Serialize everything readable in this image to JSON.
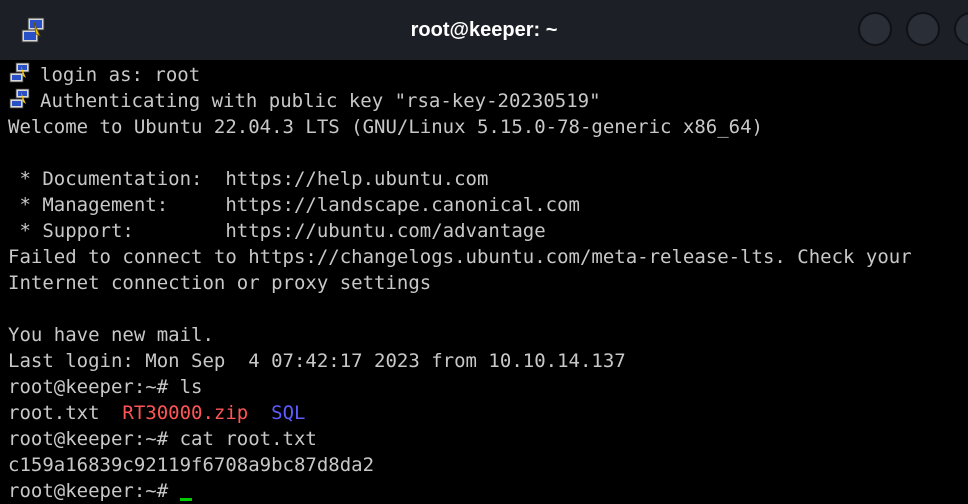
{
  "window": {
    "title": "root@keeper: ~",
    "app_icon": "putty-icon"
  },
  "terminal": {
    "line1": "login as: root",
    "line2": "Authenticating with public key \"rsa-key-20230519\"",
    "line3": "Welcome to Ubuntu 22.04.3 LTS (GNU/Linux 5.15.0-78-generic x86_64)",
    "line5": " * Documentation:  https://help.ubuntu.com",
    "line6": " * Management:     https://landscape.canonical.com",
    "line7": " * Support:        https://ubuntu.com/advantage",
    "line8": "Failed to connect to https://changelogs.ubuntu.com/meta-release-lts. Check your",
    "line9": "Internet connection or proxy settings",
    "line11": "You have new mail.",
    "line12": "Last login: Mon Sep  4 07:42:17 2023 from 10.10.14.137",
    "line13": "root@keeper:~# ls",
    "ls_output": {
      "file1": "root.txt",
      "file2": "RT30000.zip",
      "file3": "SQL"
    },
    "line15": "root@keeper:~# cat root.txt",
    "line16": "c159a16839c92119f6708a9bc87d8da2",
    "line17": "root@keeper:~# "
  },
  "colors": {
    "titlebar": "#1c1f26",
    "terminal_bg": "#000000",
    "text": "#c8c8c8",
    "archive": "#ff5555",
    "directory": "#5c5cff",
    "cursor": "#00cc00"
  }
}
